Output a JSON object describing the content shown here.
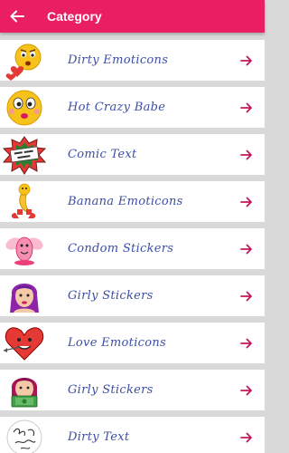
{
  "appbar": {
    "title": "Category",
    "back_icon": "arrow-left-icon",
    "color": "#e91e63"
  },
  "categories": [
    {
      "label": "Dirty Emoticons",
      "icon": "dirty-emoticon-icon"
    },
    {
      "label": "Hot Crazy Babe",
      "icon": "crazy-babe-emoji-icon"
    },
    {
      "label": "Comic Text",
      "icon": "beer-time-comic-icon"
    },
    {
      "label": "Banana Emoticons",
      "icon": "banana-emoticon-icon"
    },
    {
      "label": "Condom Stickers",
      "icon": "condom-sticker-icon"
    },
    {
      "label": "Girly Stickers",
      "icon": "girly-sticker-icon"
    },
    {
      "label": "Love Emoticons",
      "icon": "love-heart-icon"
    },
    {
      "label": "Girly Stickers",
      "icon": "girly-sticker-money-icon"
    },
    {
      "label": "Dirty Text",
      "icon": "dirty-text-icon"
    }
  ],
  "colors": {
    "label": "#3d4ea3",
    "arrow": "#c2185b",
    "row_bg": "#ffffff",
    "separator": "#d9d9d9"
  }
}
